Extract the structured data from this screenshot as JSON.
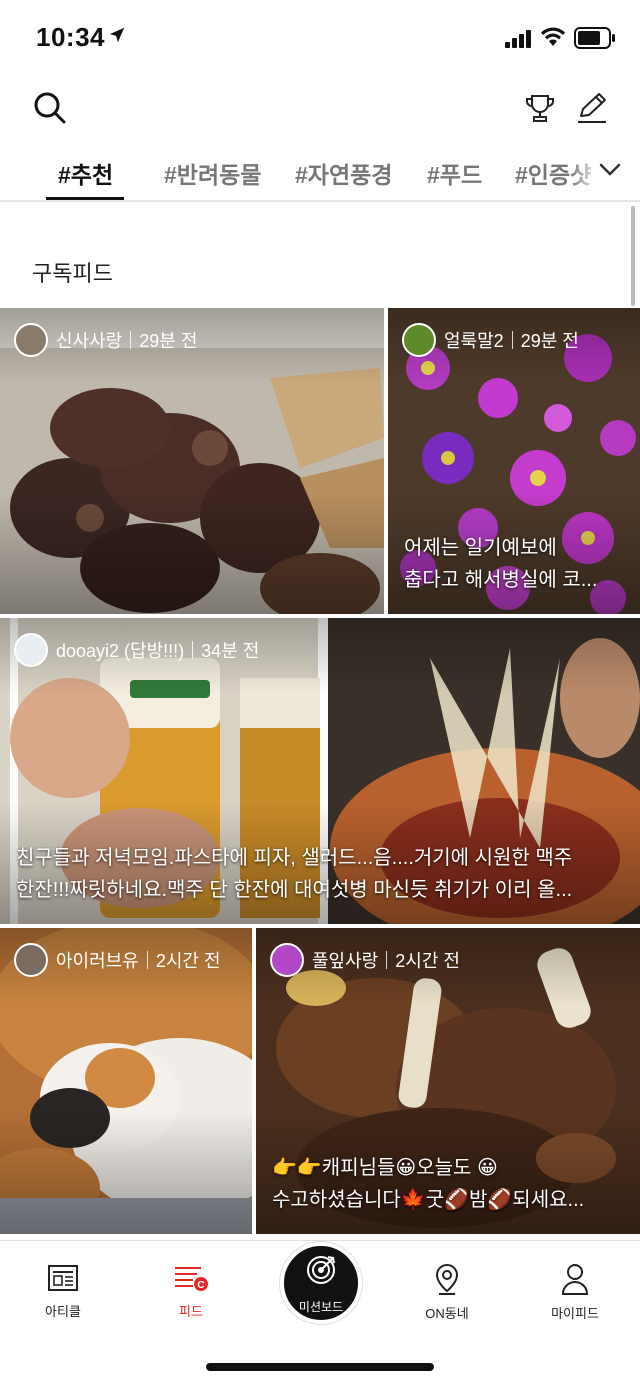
{
  "status_bar": {
    "time": "10:34"
  },
  "tabs": [
    "#추천",
    "#반려동물",
    "#자연풍경",
    "#푸드",
    "#인증샷"
  ],
  "section_title": "구독피드",
  "posts": [
    {
      "user": "신사사랑",
      "time": "29분 전",
      "caption": []
    },
    {
      "user": "얼룩말2",
      "time": "29분 전",
      "caption": [
        "어제는 일기예보에",
        "춥다고 해서병실에 코..."
      ]
    },
    {
      "user": "dooayi2 (답방!!!)",
      "time": "34분 전",
      "caption": [
        "친구들과 저녁모임.파스타에 피자, 샐러드...음....거기에 시원한 맥주",
        "한잔!!!짜릿하네요.맥주 단 한잔에 대여섯병 마신듯 취기가 이리 올..."
      ]
    },
    {
      "user": "아이러브유",
      "time": "2시간 전",
      "caption": []
    },
    {
      "user": "풀잎사랑",
      "time": "2시간 전",
      "caption": [
        "👉👉캐피님들😀오늘도 😀",
        "수고하셨습니다🍁굿🏈밤🏈되세요..."
      ]
    }
  ],
  "nav": {
    "article": "아티클",
    "feed": "피드",
    "mission": "미션보드",
    "on_neighborhood": "ON동네",
    "my_feed": "마이피드"
  },
  "colors": {
    "accent": "#e22a2a",
    "mission_bg": "#111111"
  },
  "icons": [
    "search-icon",
    "trophy-icon",
    "pencil-icon",
    "chevron-down-icon",
    "article-icon",
    "feed-icon",
    "mission-target-icon",
    "location-pin-icon",
    "person-icon"
  ]
}
